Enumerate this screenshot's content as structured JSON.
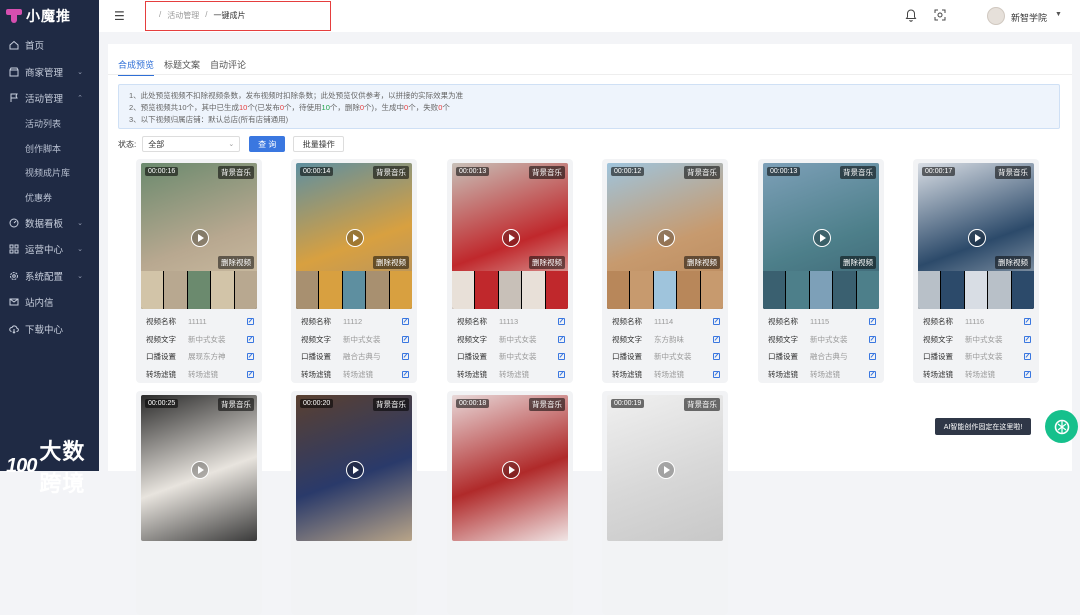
{
  "app": {
    "name": "小魔推"
  },
  "sidebar": {
    "items": [
      {
        "label": "首页",
        "icon": "home-icon",
        "arrow": ""
      },
      {
        "label": "商家管理",
        "icon": "store-icon",
        "arrow": "⌄"
      },
      {
        "label": "活动管理",
        "icon": "flag-icon",
        "arrow": "⌃"
      },
      {
        "label": "数据看板",
        "icon": "dashboard-icon",
        "arrow": "⌄"
      },
      {
        "label": "运营中心",
        "icon": "grid-icon",
        "arrow": "⌄"
      },
      {
        "label": "系统配置",
        "icon": "gear-icon",
        "arrow": "⌄"
      },
      {
        "label": "站内信",
        "icon": "mail-icon",
        "arrow": ""
      },
      {
        "label": "下载中心",
        "icon": "cloud-download-icon",
        "arrow": ""
      }
    ],
    "subitems": [
      "活动列表",
      "创作脚本",
      "视频成片库",
      "优惠券"
    ]
  },
  "watermark": {
    "logo": "100",
    "text": "大数跨境"
  },
  "header": {
    "breadcrumb": [
      "活动管理",
      "一键成片"
    ],
    "separator": "/",
    "user": "新智学院"
  },
  "tabs": [
    "合成预览",
    "标题文案",
    "自动评论"
  ],
  "notice": {
    "line1": "1、此处预览视频不扣除视频条数，发布视频时扣除条数；此处预览仅供参考，以拼接的实际效果为准",
    "line2_a": "2、预览视频共10个，其中已生成",
    "line2_b": "10",
    "line2_c": "个(已发布",
    "line2_d": "0",
    "line2_e": "个，待使用",
    "line2_f": "10",
    "line2_g": "个，删除",
    "line2_h": "0",
    "line2_i": "个)，生成中",
    "line2_j": "0",
    "line2_k": "个，失败",
    "line2_l": "0",
    "line2_m": "个",
    "line3": "3、以下视频归属店铺：默认总店(所有店铺通用)"
  },
  "filter": {
    "label": "状态:",
    "value": "全部",
    "query": "查 询",
    "batch": "批量操作"
  },
  "field_labels": [
    "视频名称",
    "视频文字",
    "口播设置",
    "转场滤镜"
  ],
  "music_label": "背景音乐",
  "delete_label": "删除视频",
  "cards": [
    {
      "duration": "00:00:16",
      "name": "11111",
      "text": "新中式女装",
      "voice": "展现东方神",
      "filter": "转场滤镜",
      "colors": [
        "#6b8a6e",
        "#b8a890",
        "#d2c4a8"
      ]
    },
    {
      "duration": "00:00:14",
      "name": "11112",
      "text": "新中式女装",
      "voice": "融合古典与",
      "filter": "转场滤镜",
      "colors": [
        "#5e8fa0",
        "#d8a040",
        "#a89070"
      ]
    },
    {
      "duration": "00:00:13",
      "name": "11113",
      "text": "新中式女装",
      "voice": "新中式女装",
      "filter": "转场滤镜",
      "colors": [
        "#c8c0b8",
        "#c0282c",
        "#e8e0d8"
      ]
    },
    {
      "duration": "00:00:12",
      "name": "11114",
      "text": "东方韵味",
      "voice": "新中式女装",
      "filter": "转场滤镜",
      "colors": [
        "#9fc4dc",
        "#c79a6e",
        "#b8875a"
      ]
    },
    {
      "duration": "00:00:13",
      "name": "11115",
      "text": "新中式女装",
      "voice": "融合古典与",
      "filter": "转场滤镜",
      "colors": [
        "#7da0b8",
        "#4d7f8a",
        "#3a6070"
      ]
    },
    {
      "duration": "00:00:17",
      "name": "11116",
      "text": "新中式女装",
      "voice": "新中式女装",
      "filter": "转场滤镜",
      "colors": [
        "#d8dde4",
        "#2c4a6a",
        "#b8c0c8"
      ]
    },
    {
      "duration": "00:00:25",
      "colors": [
        "#2a2a2a",
        "#e8e4de",
        "#3a3a3a"
      ]
    },
    {
      "duration": "00:00:20",
      "colors": [
        "#5a4030",
        "#2a3a6a",
        "#b8a488"
      ]
    },
    {
      "duration": "00:00:18",
      "colors": [
        "#e8d8d8",
        "#b02a2a",
        "#f0e6e6"
      ]
    },
    {
      "duration": "00:00:19",
      "colors": [
        "#f0f0f0",
        "#d8d8d8",
        "#c8c8c8"
      ]
    }
  ],
  "tooltip": "AI智能创作固定在这里啦!",
  "colors": {
    "accent": "#3a77e0",
    "sidebar": "#1f2a44",
    "highlight": "#e53e3e",
    "success": "#22a34a"
  }
}
